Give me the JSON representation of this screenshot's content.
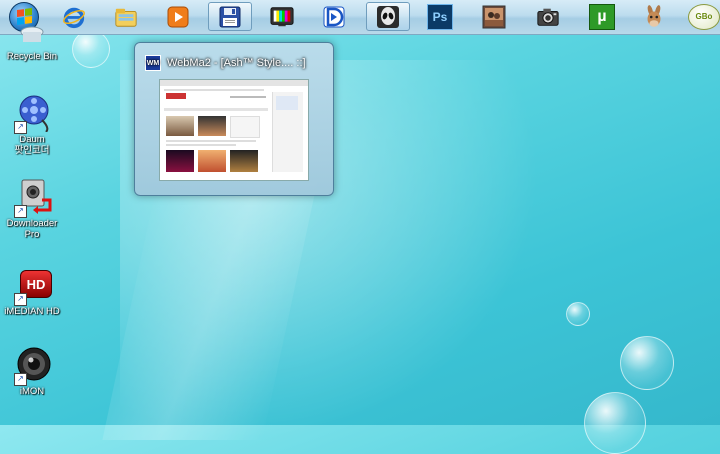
{
  "taskbar": {
    "items": [
      {
        "name": "start-button",
        "icon": "windows-orb-icon"
      },
      {
        "name": "internet-explorer",
        "icon": "ie-icon"
      },
      {
        "name": "windows-explorer",
        "icon": "folder-icon"
      },
      {
        "name": "media-player",
        "icon": "media-player-icon"
      },
      {
        "name": "webma2",
        "icon": "floppy-save-icon",
        "active": true
      },
      {
        "name": "tv-player",
        "icon": "tv-color-bars-icon"
      },
      {
        "name": "daum-potplayer",
        "icon": "play-d-icon"
      },
      {
        "name": "alien-app",
        "icon": "alien-icon"
      },
      {
        "name": "photoshop",
        "icon": "photoshop-icon",
        "label": "Ps"
      },
      {
        "name": "photo-viewer",
        "icon": "photo-icon"
      },
      {
        "name": "camera-app",
        "icon": "camera-icon"
      },
      {
        "name": "utorrent",
        "icon": "utorrent-icon",
        "label": "µ"
      },
      {
        "name": "emule",
        "icon": "donkey-icon"
      },
      {
        "name": "gbox",
        "icon": "gbox-icon",
        "label": "GBo"
      }
    ]
  },
  "thumbnail": {
    "title": "WebMa2 - [Ash™ Style.... ::]",
    "app_badge": "WM"
  },
  "desktop": {
    "icons": [
      {
        "label": "Recycle Bin"
      },
      {
        "label": "Daum\n팟인코더"
      },
      {
        "label": "Downloader\nPro"
      },
      {
        "label": "iMEDIAN HD",
        "badge": "HD"
      },
      {
        "label": "iMON"
      }
    ]
  },
  "colors": {
    "desktop_top": "#8fe8f0",
    "desktop_bottom": "#35b8cc",
    "taskbar": "#bcdcee",
    "ps_blue": "#0b3a66",
    "utorrent_green": "#2e9a28"
  }
}
